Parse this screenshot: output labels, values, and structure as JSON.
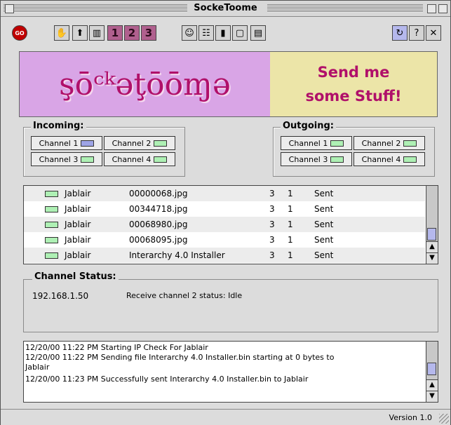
{
  "window": {
    "title": "SockeToome"
  },
  "toolbar": {
    "go_label": "GO",
    "n1": "1",
    "n2": "2",
    "n3": "3"
  },
  "banner": {
    "logo": "şōᶜᵏəţōōɱə",
    "send_line1": "Send me",
    "send_line2": "some Stuff!"
  },
  "incoming": {
    "label": "Incoming:",
    "channels": [
      "Channel 1",
      "Channel 2",
      "Channel 3",
      "Channel 4"
    ]
  },
  "outgoing": {
    "label": "Outgoing:",
    "channels": [
      "Channel 1",
      "Channel 2",
      "Channel 3",
      "Channel 4"
    ]
  },
  "transfers": [
    {
      "user": "Jablair",
      "file": "00000068.jpg",
      "c1": "3",
      "c2": "1",
      "status": "Sent"
    },
    {
      "user": "Jablair",
      "file": "00344718.jpg",
      "c1": "3",
      "c2": "1",
      "status": "Sent"
    },
    {
      "user": "Jablair",
      "file": "00068980.jpg",
      "c1": "3",
      "c2": "1",
      "status": "Sent"
    },
    {
      "user": "Jablair",
      "file": "00068095.jpg",
      "c1": "3",
      "c2": "1",
      "status": "Sent"
    },
    {
      "user": "Jablair",
      "file": "Interarchy 4.0 Installer",
      "c1": "3",
      "c2": "1",
      "status": "Sent"
    }
  ],
  "channel_status": {
    "label": "Channel Status:",
    "ip": "192.168.1.50",
    "message": "Receive channel 2 status: Idle"
  },
  "log": [
    "12/20/00 11:22 PM Starting IP Check For Jablair",
    "12/20/00 11:22 PM Sending file Interarchy 4.0 Installer.bin starting at 0 bytes to",
    "Jablair",
    "12/20/00 11:23 PM Successfully sent Interarchy 4.0 Installer.bin to Jablair"
  ],
  "footer": {
    "version": "Version 1.0"
  },
  "colors": {
    "logo_bg": "#d9a5e6",
    "send_bg": "#ece5a8",
    "accent": "#b0106a",
    "led_green": "#aef0b4",
    "led_blue": "#9ea4e6"
  }
}
